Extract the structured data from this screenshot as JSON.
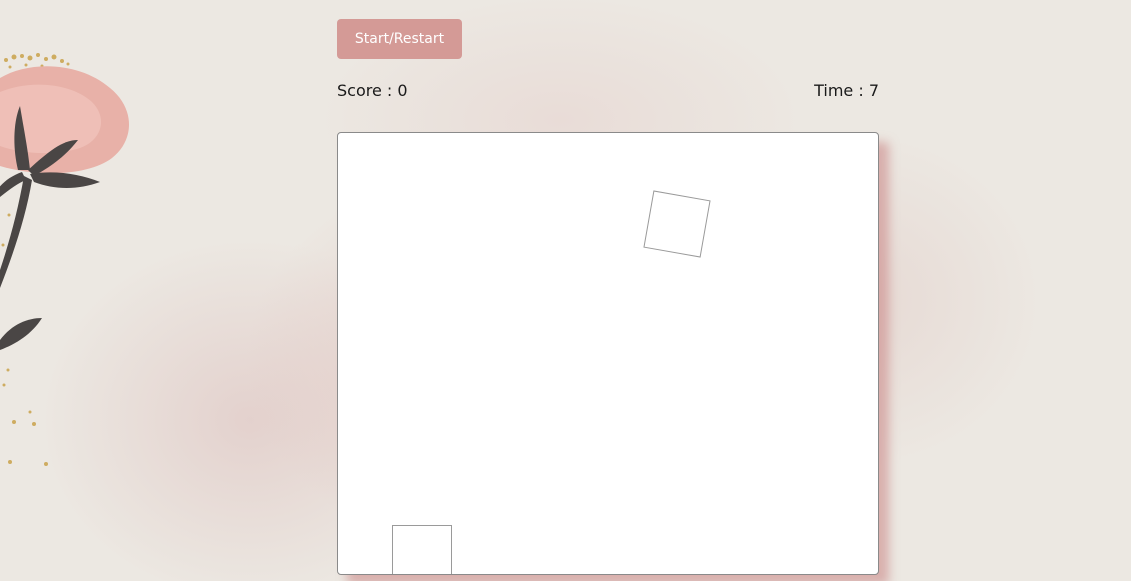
{
  "controls": {
    "start_label": "Start/Restart"
  },
  "status": {
    "score_text": "Score : 0",
    "time_text": "Time : 7",
    "score": 0,
    "time": 7
  },
  "game": {
    "squares": [
      {
        "role": "falling",
        "rotation_deg": 10
      },
      {
        "role": "catcher",
        "rotation_deg": 0
      }
    ]
  },
  "colors": {
    "button": "#d49a96",
    "board_shadow": "#c88282",
    "petal": "#e8b1a8",
    "stem": "#4a4645",
    "gold": "#c9a24a"
  }
}
